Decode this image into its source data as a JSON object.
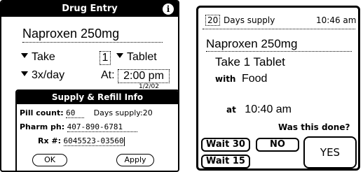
{
  "drug_entry": {
    "title": "Drug Entry",
    "info_icon": "i",
    "drug_name": "Naproxen 250mg",
    "take_label": "Take",
    "take_qty": "1",
    "unit": "Tablet",
    "frequency": "3x/day",
    "at_label": "At:",
    "time": "2:00 pm",
    "partial_text": "1/2/02"
  },
  "supply_dialog": {
    "title": "Supply & Refill Info",
    "pill_count_label": "Pill count:",
    "pill_count": "60",
    "days_supply_label": "Days supply:",
    "days_supply": "20",
    "pharm_label": "Pharm ph:",
    "pharm_phone": "407-890-6781",
    "rx_label": "Rx #:",
    "rx_number": "6045523-03560",
    "ok_label": "OK",
    "apply_label": "Apply"
  },
  "reminder": {
    "days_supply": "20",
    "days_supply_label": "Days supply",
    "clock": "10:46 am",
    "drug_name": "Naproxen 250mg",
    "instruction": "Take 1 Tablet",
    "with_label": "with",
    "with_value": "Food",
    "at_label": "at",
    "at_time": "10:40 am",
    "question": "Was this done?",
    "wait30_label": "Wait 30",
    "no_label": "NO",
    "wait15_label": "Wait 15",
    "yes_label": "YES"
  }
}
